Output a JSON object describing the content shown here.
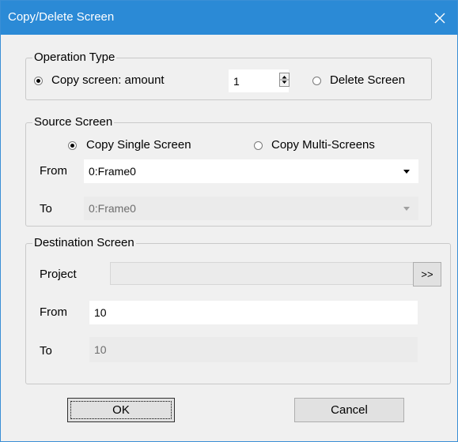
{
  "window": {
    "title": "Copy/Delete Screen"
  },
  "operation_type": {
    "legend": "Operation Type",
    "copy_label": "Copy screen: amount",
    "amount": "1",
    "delete_label": "Delete Screen",
    "selected": "copy"
  },
  "source_screen": {
    "legend": "Source Screen",
    "single_label": "Copy Single Screen",
    "multi_label": "Copy Multi-Screens",
    "selected": "single",
    "from_label": "From",
    "from_value": "0:Frame0",
    "to_label": "To",
    "to_value": "0:Frame0"
  },
  "destination_screen": {
    "legend": "Destination Screen",
    "project_label": "Project",
    "project_value": "",
    "browse_label": ">>",
    "from_label": "From",
    "from_value": "10",
    "to_label": "To",
    "to_value": "10"
  },
  "buttons": {
    "ok": "OK",
    "cancel": "Cancel"
  },
  "colors": {
    "titlebar": "#2b8ad6",
    "dialog_bg": "#f0f0f0",
    "disabled_field": "#ebebeb"
  },
  "icons": {
    "close": "close-icon",
    "spinner": "spinner-icon",
    "dropdown": "chevron-down-icon"
  }
}
